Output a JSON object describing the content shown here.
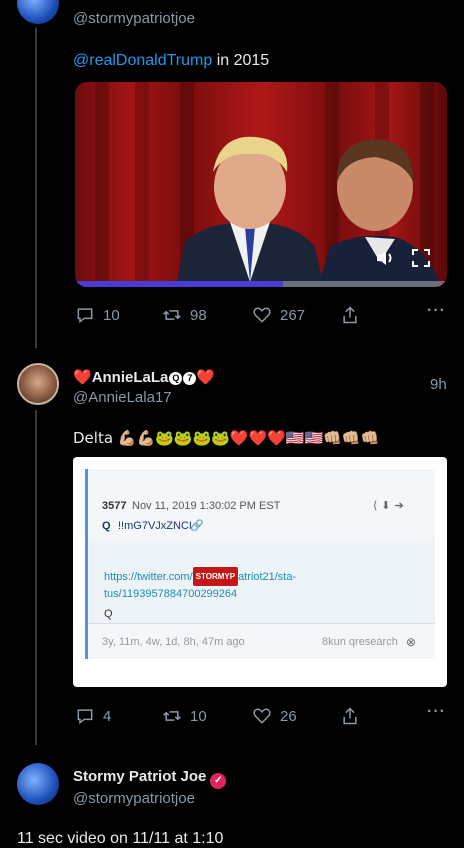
{
  "tweet1": {
    "handle": "@stormypatriotjoe",
    "text_mention": "@realDonaldTrump",
    "text_rest": " in 2015",
    "actions": {
      "replies": "10",
      "retweets": "98",
      "likes": "267"
    },
    "video_progress": 0.56
  },
  "tweet2": {
    "name": "AnnieLaLa",
    "handle": "@AnnieLala17",
    "time": "9h",
    "text": "Delta 💪🏼💪🏼🐸🐸🐸🐸❤️❤️❤️🇺🇸🇺🇸👊🏼👊🏼👊🏼",
    "actions": {
      "replies": "4",
      "retweets": "10",
      "likes": "26"
    },
    "card": {
      "post_num": "3577",
      "date": "Nov 11, 2019 1:30:02 PM EST",
      "author": "Q",
      "trip": "!!mG7VJxZNCI",
      "link_prefix": "https://twitter.com/",
      "badge": "STORMYP",
      "link_suffix": "atriot21/sta-",
      "link_line2": "tus/1193957884700299264",
      "q_sign": "Q",
      "age": "3y, 11m, 4w, 1d, 8h, 47m ago",
      "source": "8kun qresearch"
    }
  },
  "tweet3": {
    "name": "Stormy Patriot Joe",
    "handle": "@stormypatriotjoe",
    "text": "11 sec video on 11/11 at 1:10"
  },
  "colors": {
    "link": "#1d9bf0",
    "background": "#000000",
    "muted": "#8b98a5"
  }
}
